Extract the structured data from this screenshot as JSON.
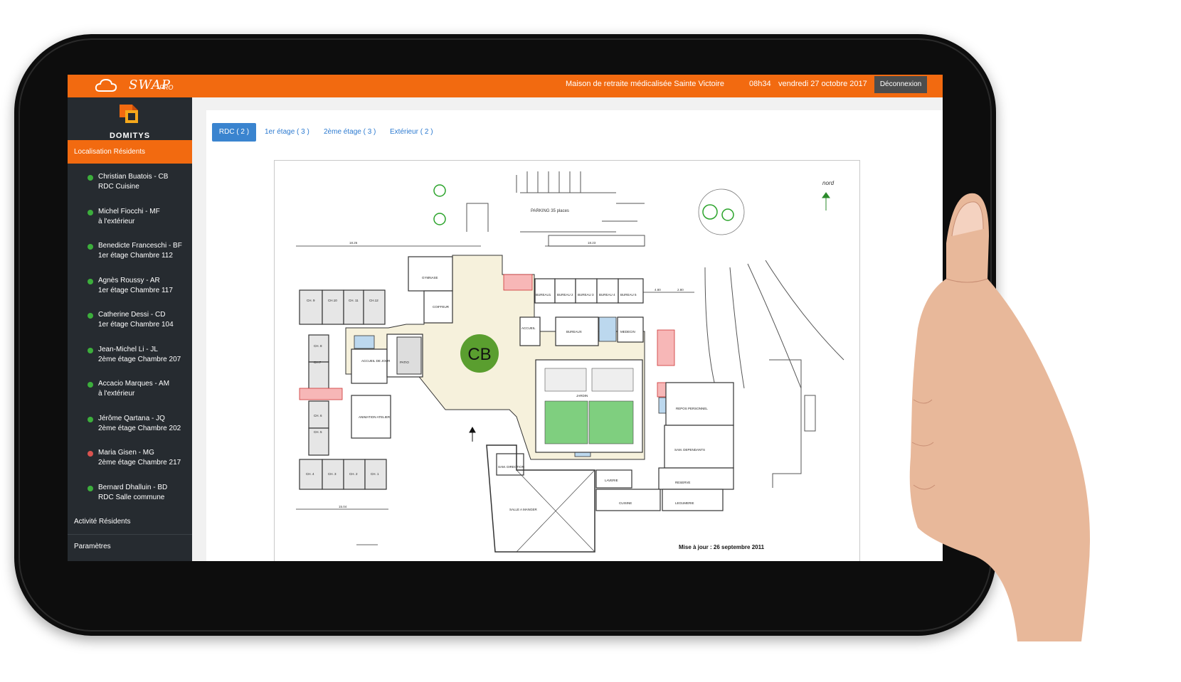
{
  "topbar": {
    "brand": "SWAP",
    "brand_suffix": "PRO",
    "facility": "Maison de retraite médicalisée Sainte Victoire",
    "time": "08h34",
    "date": "vendredi 27 octobre 2017",
    "logout_label": "Déconnexion",
    "color": "#f26a10"
  },
  "sidebar": {
    "logo_text": "DOMITYS",
    "active_section": "Localisation Résidents",
    "residents": [
      {
        "name": "Christian Buatois - CB",
        "location": "RDC Cuisine",
        "status_color": "#3cae3c"
      },
      {
        "name": "Michel Fiocchi - MF",
        "location": "à l'extérieur",
        "status_color": "#3cae3c"
      },
      {
        "name": "Benedicte Franceschi - BF",
        "location": "1er étage Chambre 112",
        "status_color": "#3cae3c"
      },
      {
        "name": "Agnès Roussy - AR",
        "location": "1er étage Chambre 117",
        "status_color": "#3cae3c"
      },
      {
        "name": "Catherine Dessi - CD",
        "location": "1er étage Chambre 104",
        "status_color": "#3cae3c"
      },
      {
        "name": "Jean-Michel Li - JL",
        "location": "2ème étage Chambre 207",
        "status_color": "#3cae3c"
      },
      {
        "name": "Accacio Marques - AM",
        "location": "à l'extérieur",
        "status_color": "#3cae3c"
      },
      {
        "name": "Jérôme Qartana - JQ",
        "location": "2ème étage Chambre 202",
        "status_color": "#3cae3c"
      },
      {
        "name": "Maria Gisen - MG",
        "location": "2ème étage Chambre 217",
        "status_color": "#d9534f"
      },
      {
        "name": "Bernard Dhalluin - BD",
        "location": "RDC Salle commune",
        "status_color": "#3cae3c"
      }
    ],
    "nav": [
      "Activité Résidents",
      "Paramètres"
    ]
  },
  "tabs": [
    "RDC ( 2 )",
    "1er étage ( 3 )",
    "2ème étage ( 3 )",
    "Extérieur ( 2 )"
  ],
  "floorplan": {
    "marker": "CB",
    "marker_color": "#5a9e2f",
    "parking": "PARKING  35 places",
    "north": "nord",
    "updated": "Mise à jour : 26 septembre 2011",
    "rooms": {
      "gymnase": "GYMNASE",
      "coiffeur": "COIFFEUR",
      "bureau1": "BUREAU1",
      "bureau2": "BUREAU 2",
      "bureau3": "BUREAU 3",
      "bureau4": "BUREAU 4",
      "bureau5": "BUREAU 5",
      "accueil": "ACCUEIL",
      "bureaux": "BUREAUX",
      "medecin": "MEDECIN",
      "accueil_jour": "ACCUEIL DE JOUR",
      "patio": "PATIO",
      "jardin": "JARDIN",
      "animation": "ANIMATION ATELIER",
      "repos": "REPOS PERSONNEL",
      "sam_dependants": "SAM. DEPENDANTS",
      "sam_direction": "SAM. DIRECTION",
      "salle_manger": "SALLE A MANGER",
      "laverie": "LAVERIE",
      "reserve": "RESERVE",
      "cuisine": "CUISINE",
      "legumerie": "LEGUMERIE",
      "ch9": "CH. 9",
      "ch10": "CH.10",
      "ch11": "CH. 11",
      "ch12": "CH.12",
      "ch8": "CH. 8",
      "ch7": "CH.7",
      "ch6": "CH. 6",
      "ch5": "CH. 5",
      "ch4": "CH. 4",
      "ch3": "CH. 3",
      "ch2": "CH. 2",
      "ch1": "CH. 1"
    },
    "dims": {
      "d1": "18.26",
      "d2": "18.23",
      "d3": "15.04",
      "d4": "4.80",
      "d5": "2.80"
    }
  }
}
